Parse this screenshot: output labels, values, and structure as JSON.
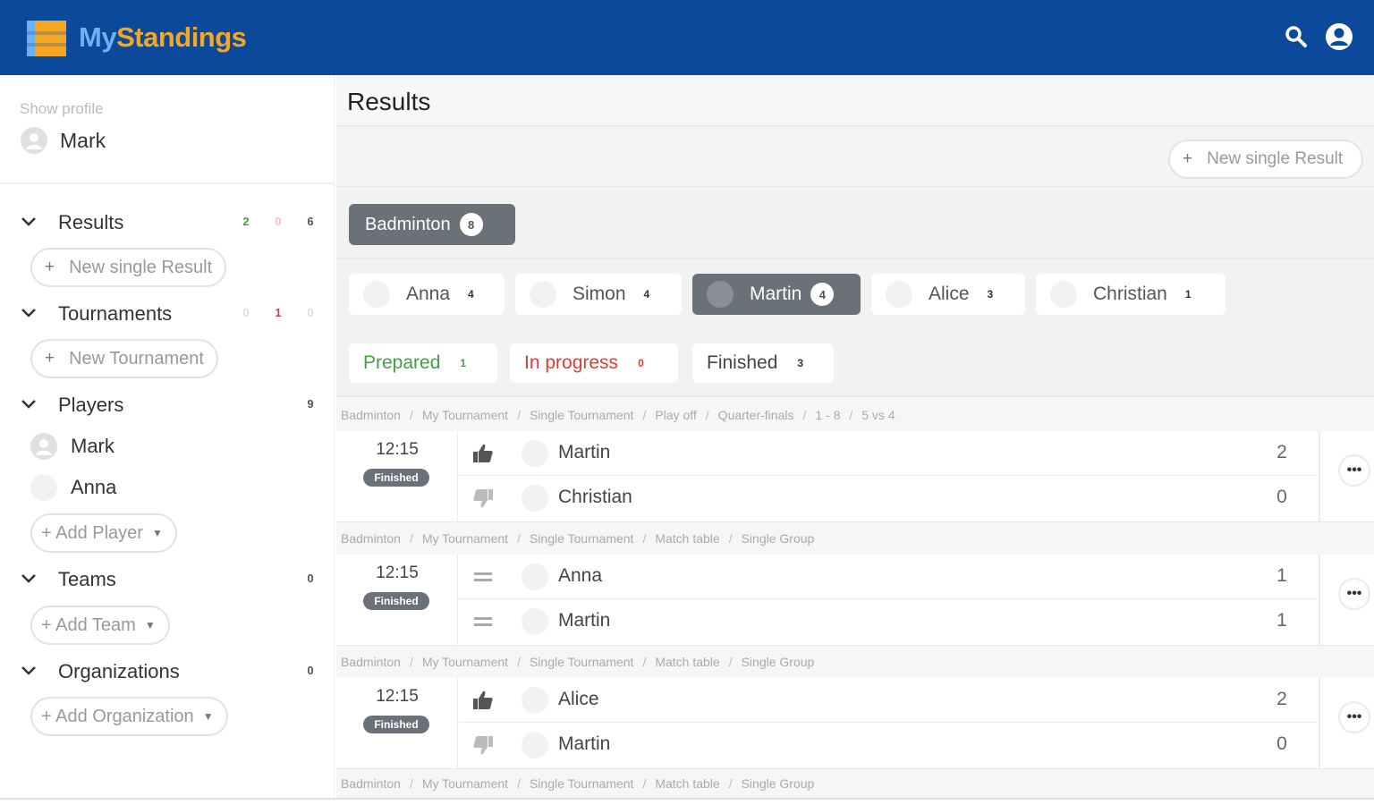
{
  "app": {
    "brand_my": "My",
    "brand_standings": "Standings"
  },
  "colors": {
    "primary": "#0b4a9a",
    "brand_light": "#6fb1f0",
    "brand_orange": "#f5a623",
    "chip_dark": "#6b7178",
    "green": "#43a047",
    "red": "#e53935"
  },
  "profile": {
    "caption": "Show profile",
    "name": "Mark"
  },
  "sidebar": {
    "results": {
      "title": "Results",
      "counts": [
        "2",
        "0",
        "6"
      ],
      "button": "New  single Result"
    },
    "tournaments": {
      "title": "Tournaments",
      "counts": [
        "0",
        "1",
        "0"
      ],
      "button": "New  Tournament"
    },
    "players": {
      "title": "Players",
      "count": "9",
      "items": [
        "Mark",
        "Anna"
      ],
      "button": "+ Add Player"
    },
    "teams": {
      "title": "Teams",
      "count": "0",
      "button": "+ Add Team"
    },
    "organizations": {
      "title": "Organizations",
      "count": "0",
      "button": "+ Add Organization"
    }
  },
  "main": {
    "title": "Results",
    "new_result_button": "New  single Result",
    "sport": {
      "label": "Badminton",
      "count": "8"
    },
    "players": [
      {
        "name": "Anna",
        "count": "4"
      },
      {
        "name": "Simon",
        "count": "4"
      },
      {
        "name": "Martin",
        "count": "4"
      },
      {
        "name": "Alice",
        "count": "3"
      },
      {
        "name": "Christian",
        "count": "1"
      }
    ],
    "statuses": [
      {
        "label": "Prepared",
        "count": "1"
      },
      {
        "label": "In progress",
        "count": "0"
      },
      {
        "label": "Finished",
        "count": "3"
      }
    ],
    "crumbs": [
      [
        "Badminton",
        "My Tournament",
        "Single Tournament",
        "Play off",
        "Quarter-finals",
        "1 - 8",
        "5 vs 4"
      ],
      [
        "Badminton",
        "My Tournament",
        "Single Tournament",
        "Match table",
        "Single Group"
      ],
      [
        "Badminton",
        "My Tournament",
        "Single Tournament",
        "Match table",
        "Single Group"
      ],
      [
        "Badminton",
        "My Tournament",
        "Single Tournament",
        "Match table",
        "Single Group"
      ]
    ],
    "matches": [
      {
        "time": "12:15",
        "status": "Finished",
        "p1": "Martin",
        "s1": "2",
        "r1": "thumbs-up",
        "p2": "Christian",
        "s2": "0",
        "r2": "thumbs-down"
      },
      {
        "time": "12:15",
        "status": "Finished",
        "p1": "Anna",
        "s1": "1",
        "r1": "equals",
        "p2": "Martin",
        "s2": "1",
        "r2": "equals"
      },
      {
        "time": "12:15",
        "status": "Finished",
        "p1": "Alice",
        "s1": "2",
        "r1": "thumbs-up",
        "p2": "Martin",
        "s2": "0",
        "r2": "thumbs-down"
      }
    ]
  }
}
